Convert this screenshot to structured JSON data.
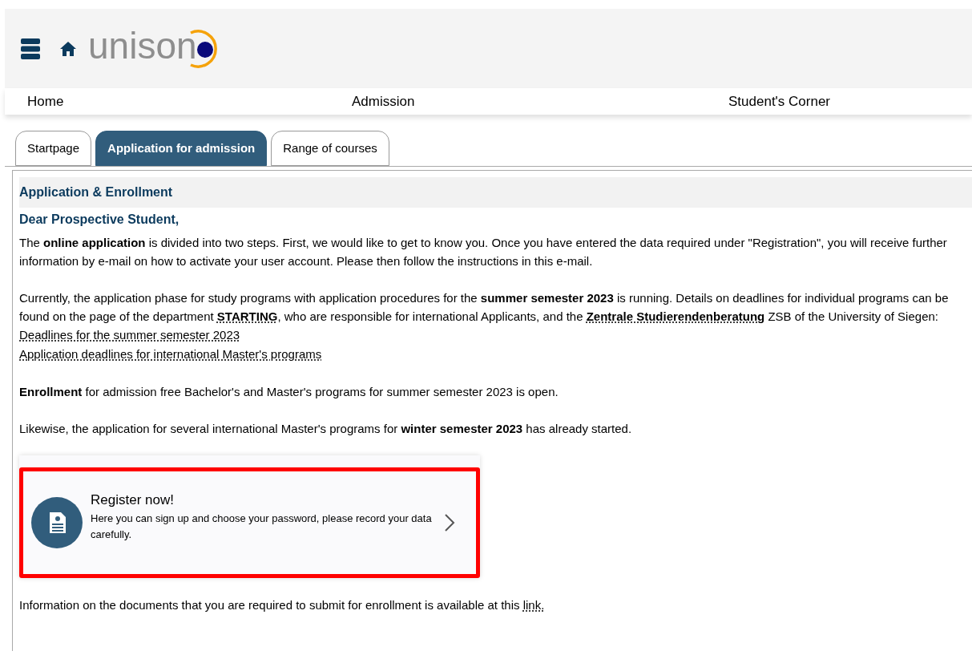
{
  "header": {
    "logo_text": "unison"
  },
  "nav": [
    "Home",
    "Admission",
    "Student's Corner"
  ],
  "tabs": [
    {
      "label": "Startpage",
      "selected": false
    },
    {
      "label": "Application for admission",
      "selected": true
    },
    {
      "label": "Range of courses",
      "selected": false
    }
  ],
  "section_title": "Application & Enrollment",
  "greeting": "Dear Prospective Student,",
  "paragraphs": [
    [
      {
        "kind": "plain",
        "text": "The "
      },
      {
        "kind": "bold",
        "text": "online application"
      },
      {
        "kind": "plain",
        "text": " is divided into two steps. First, we would like to get to know you. Once you have entered the data required under \"Registration\", you will receive further information by e-mail on how to activate your user account. Please then follow the instructions in this e-mail."
      }
    ],
    [
      {
        "kind": "plain",
        "text": "Currently, the application phase for study programs with application procedures for the "
      },
      {
        "kind": "bold",
        "text": "summer semester 2023"
      },
      {
        "kind": "plain",
        "text": " is running. Details on deadlines for individual programs can be found on the page of the department "
      },
      {
        "kind": "link",
        "text": "STARTING"
      },
      {
        "kind": "plain",
        "text": ", who are responsible for international Applicants, and the "
      },
      {
        "kind": "link",
        "text": "Zentrale Studierendenberatung"
      },
      {
        "kind": "plain",
        "text": " ZSB of the University of Siegen:"
      }
    ]
  ],
  "links": [
    "Deadlines for the summer semester 2023",
    "Application deadlines for international Master's programs"
  ],
  "paragraphs_after": [
    [
      {
        "kind": "bold",
        "text": "Enrollment"
      },
      {
        "kind": "plain",
        "text": " for admission free Bachelor's and Master's programs for summer semester 2023 is open."
      }
    ],
    [
      {
        "kind": "plain",
        "text": "Likewise, the application for several international Master's programs for "
      },
      {
        "kind": "bold",
        "text": "winter semester 2023"
      },
      {
        "kind": "plain",
        "text": " has already started."
      }
    ]
  ],
  "register_card": {
    "title": "Register now!",
    "description": "Here you can sign up and choose your password, please record your data carefully.",
    "highlighted": true
  },
  "footer_paragraph": [
    {
      "kind": "plain",
      "text": "Information on the documents that you are required to submit for enrollment is available at this "
    },
    {
      "kind": "plainlink",
      "text": "link."
    }
  ]
}
